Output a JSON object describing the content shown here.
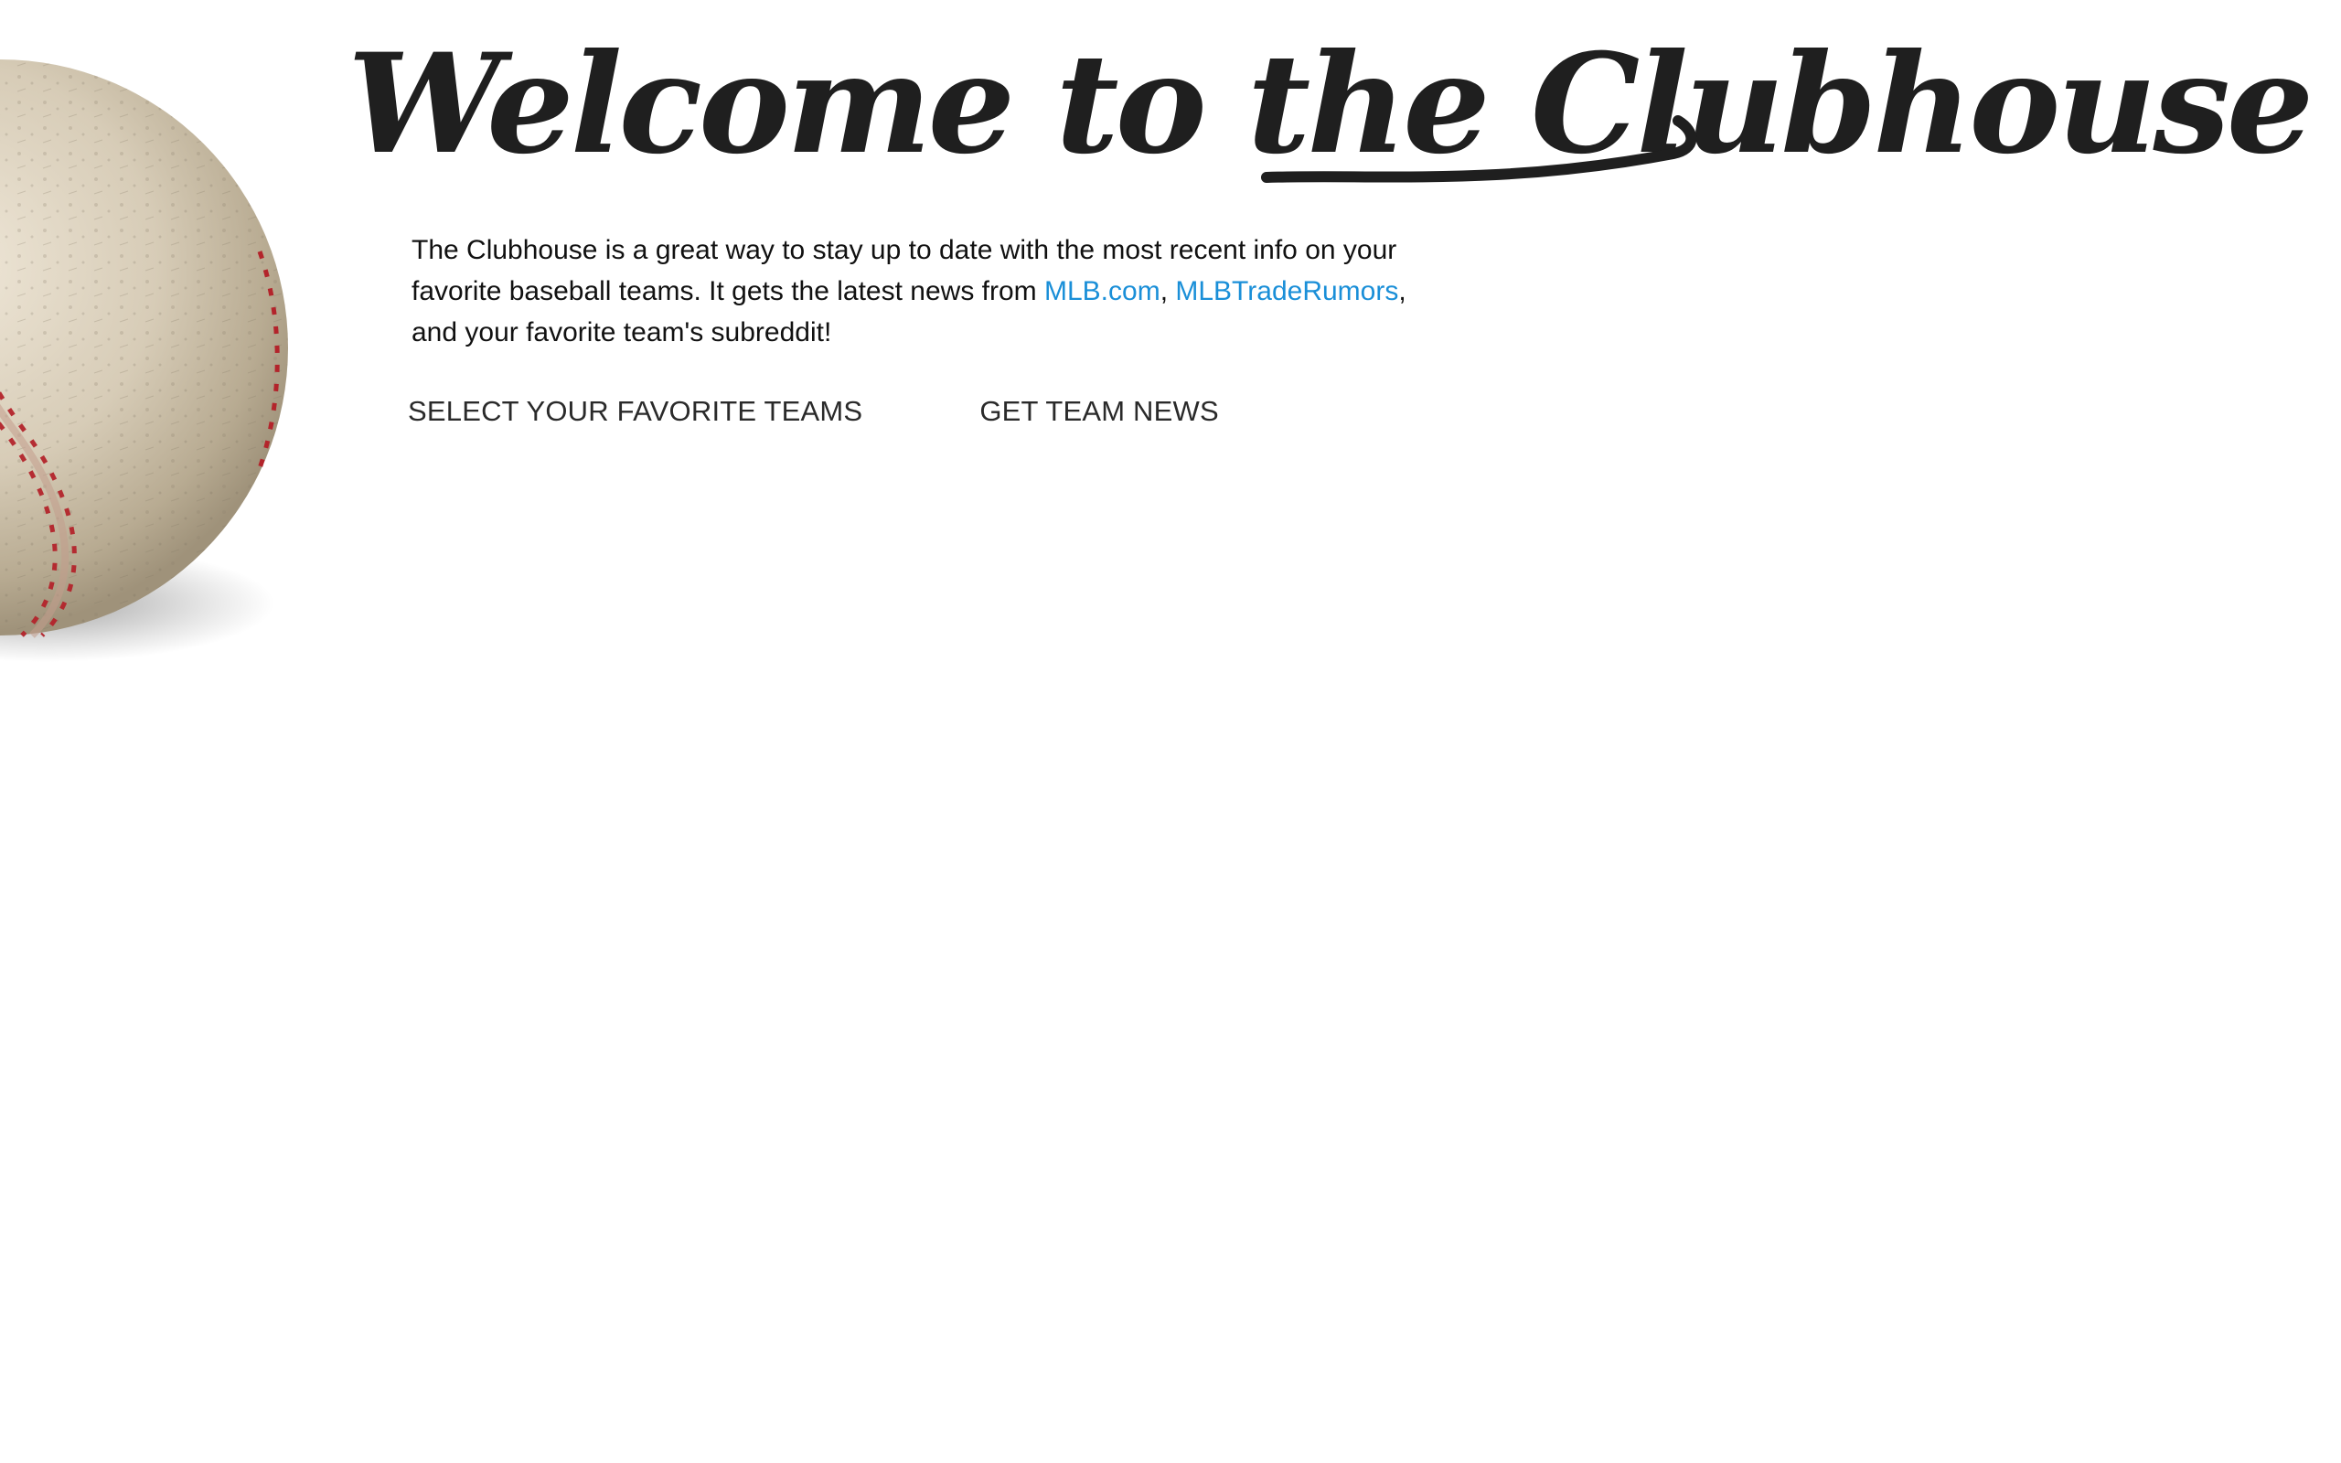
{
  "hero": {
    "title": "Welcome to the Clubhouse",
    "image": "baseball"
  },
  "intro": {
    "text_before": "The Clubhouse is a great way to stay up to date with the most recent info on your favorite baseball teams. It gets the latest news from ",
    "link_mlb": "MLB.com",
    "separator": ", ",
    "link_trade_rumors": "MLBTradeRumors",
    "text_after": ", and your favorite team's subreddit!"
  },
  "nav": {
    "select_teams": "SELECT YOUR FAVORITE TEAMS",
    "get_news": "GET TEAM NEWS"
  },
  "colors": {
    "link": "#1a8fd8",
    "title": "#1f1f1f",
    "stitch": "#b3242b",
    "ball": "#d8cfbe"
  }
}
